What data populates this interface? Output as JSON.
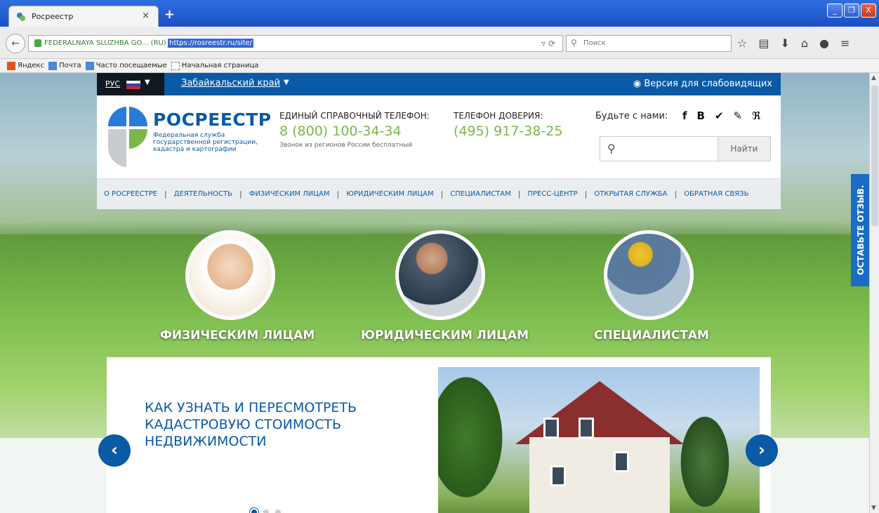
{
  "browser": {
    "tab_title": "Росреестр",
    "tab_close": "×",
    "new_tab": "+",
    "url_site": "FEDERALNAYA SLUZHBA GO... (RU)",
    "url": "https://rosreestr.ru/site/",
    "search_placeholder": "Поиск",
    "window_buttons": [
      "_",
      "❐",
      "X"
    ]
  },
  "bookmarks": [
    {
      "label": "Яндекс",
      "color": "#e0561b"
    },
    {
      "label": "Почта",
      "color": "#4a8ad8"
    },
    {
      "label": "Часто посещаемые",
      "color": "#4a8ad8"
    },
    {
      "label": "Начальная страница",
      "color": "#dddddd"
    }
  ],
  "top_strip": {
    "lang": "РУС",
    "region": "Забайкальский край",
    "vision": "Версия для слабовидящих"
  },
  "header": {
    "logo_title": "РОСРЕЕСТР",
    "logo_sub": "Федеральная служба государственной регистрации, кадастра и картографии",
    "phone_label": "ЕДИНЫЙ СПРАВОЧНЫЙ ТЕЛЕФОН:",
    "phone": "8 (800) 100-34-34",
    "phone_note": "Звонок из регионов России бесплатный",
    "trust_label": "ТЕЛЕФОН ДОВЕРИЯ:",
    "trust_phone": "(495) 917-38-25",
    "social_label": "Будьте с нами:",
    "social_icons": [
      "f",
      "B",
      "✔",
      "✎",
      "ℜ"
    ],
    "search_button": "Найти"
  },
  "menu": [
    "О РОСРЕЕСТРЕ",
    "ДЕЯТЕЛЬНОСТЬ",
    "ФИЗИЧЕСКИМ ЛИЦАМ",
    "ЮРИДИЧЕСКИМ ЛИЦАМ",
    "СПЕЦИАЛИСТАМ",
    "ПРЕСС-ЦЕНТР",
    "ОТКРЫТАЯ СЛУЖБА",
    "ОБРАТНАЯ СВЯЗЬ"
  ],
  "feedback_tab": "ОСТАВЬТЕ ОТЗЫВ.",
  "categories": [
    {
      "label": "ФИЗИЧЕСКИМ ЛИЦАМ"
    },
    {
      "label": "ЮРИДИЧЕСКИМ ЛИЦАМ"
    },
    {
      "label": "СПЕЦИАЛИСТАМ"
    }
  ],
  "slider": {
    "text": "КАК УЗНАТЬ И ПЕРЕСМОТРЕТЬ КАДАСТРОВУЮ СТОИМОСТЬ НЕДВИЖИМОСТИ",
    "prev": "‹",
    "next": "›",
    "dots": 3,
    "active_dot": 0
  },
  "colors": {
    "brand_blue": "#0a5aa6",
    "phone_green": "#7ab648"
  }
}
